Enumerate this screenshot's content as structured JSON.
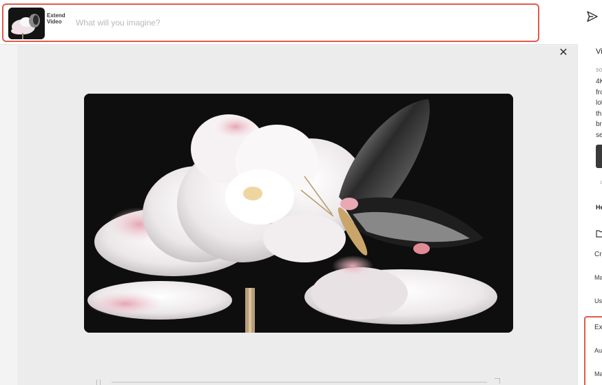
{
  "prompt_bar": {
    "extend_label": "Extend Video",
    "placeholder": "What will you imagine?",
    "send_icon": "send-icon"
  },
  "viewer": {
    "close_icon": "close-icon",
    "scrubber_icons": [
      "pause-icon",
      "fullscreen-icon"
    ]
  },
  "right_panel": {
    "title": "Vi",
    "source": "so",
    "description_lines": [
      "4K",
      "fro",
      "lot",
      "th",
      "br",
      "se"
    ],
    "small_label": "a",
    "heading": "He",
    "folder_icon": "folder-icon",
    "items": [
      "Cr",
      "Ma",
      "Us"
    ],
    "highlighted_items": [
      "Ex",
      "Au",
      "Ma"
    ]
  },
  "colors": {
    "highlight": "#e05a4a",
    "background": "#f3f3f3"
  }
}
